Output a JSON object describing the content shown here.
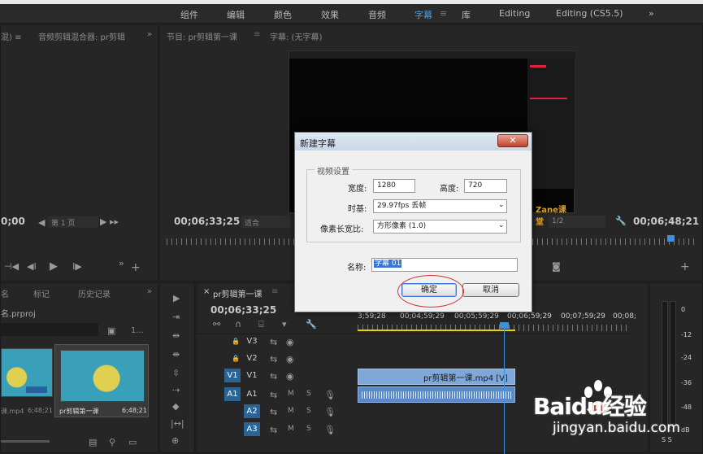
{
  "workspace": {
    "tabs": [
      {
        "label": "组件"
      },
      {
        "label": "编辑"
      },
      {
        "label": "颜色"
      },
      {
        "label": "效果"
      },
      {
        "label": "音频"
      },
      {
        "label": "字幕"
      },
      {
        "label": "库"
      },
      {
        "label": "Editing"
      },
      {
        "label": "Editing (CS5.5)"
      }
    ],
    "active_tab": "字幕",
    "overflow": "»"
  },
  "source_panel": {
    "title_left": "音频剪辑混合器: pr剪辑",
    "overflow": "»",
    "timecode": "0;00",
    "page_label": "第 1 页"
  },
  "program_panel": {
    "title": "节目: pr剪辑第一课",
    "title2": "字幕: (无字幕)",
    "timecode_left": "00;06;33;25",
    "fit_label": "适合",
    "timecode_right": "00;06;48;21",
    "zoom_label": "1/2",
    "watermark": "Zane课堂"
  },
  "project_panel": {
    "tabs": [
      "名",
      "标记",
      "历史记录"
    ],
    "overflow": "»",
    "project_name": "名.prproj",
    "count": "1...",
    "items": [
      {
        "name": "课.mp4",
        "duration": "6;48;21"
      },
      {
        "name": "pr剪辑第一课",
        "duration": "6;48;21"
      }
    ]
  },
  "timeline": {
    "tab_label": "pr剪辑第一课",
    "timecode": "00;06;33;25",
    "ruler_times": [
      "3;59;28",
      "00;04;59;29",
      "00;05;59;29",
      "00;06;59;29",
      "00;07;59;29",
      "00;08;"
    ],
    "tracks": [
      {
        "name": "V3"
      },
      {
        "name": "V2"
      },
      {
        "name": "V1"
      },
      {
        "name": "A1"
      },
      {
        "name": "A2"
      },
      {
        "name": "A3"
      }
    ],
    "clip_label": "pr剪辑第一课.mp4 [V]",
    "mute": "M",
    "solo": "S"
  },
  "audio_meter": {
    "scale": [
      "0",
      "-12",
      "-24",
      "-36",
      "-48",
      "dB"
    ],
    "solo_label": "S S"
  },
  "dialog": {
    "title": "新建字幕",
    "section": "视频设置",
    "width_label": "宽度:",
    "width_value": "1280",
    "height_label": "高度:",
    "height_value": "720",
    "timebase_label": "时基:",
    "timebase_value": "29.97fps 丢帧",
    "par_label": "像素长宽比:",
    "par_value": "方形像素 (1.0)",
    "name_label": "名称:",
    "name_value": "字幕 01",
    "ok_label": "确定",
    "cancel_label": "取消"
  },
  "watermark_logo": {
    "brand": "Baidu经验",
    "url": "jingyan.baidu.com"
  }
}
